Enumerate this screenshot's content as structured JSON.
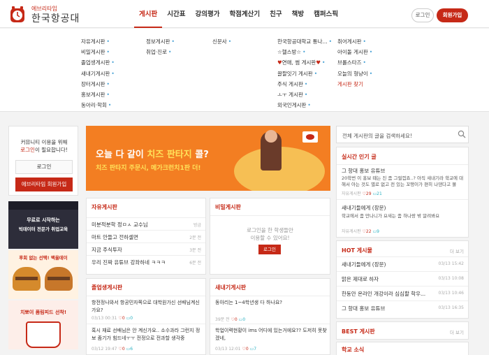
{
  "header": {
    "logo_sub": "에브리타임",
    "logo_main": "한국항공대",
    "nav": [
      "게시판",
      "시간표",
      "강의평가",
      "학점계산기",
      "친구",
      "책방",
      "캠퍼스픽"
    ],
    "login": "로그인",
    "signup": "회원가입"
  },
  "menu": {
    "col1": [
      "자유게시판",
      "비밀게시판",
      "졸업생게시판",
      "새내기게시판",
      "장터게시판",
      "홍보게시판",
      "동아리·학회"
    ],
    "col2": [
      "정보게시판",
      "취업·진로"
    ],
    "col3": [
      "신문사"
    ],
    "col4": [
      "한국항공대학교 통나...",
      "☆헬스방☆",
      "연애, 썸 게시판",
      "끌팔잇기 게시판",
      "주식 게시판",
      "ㅗㅜ 게시판",
      "외국인게시판"
    ],
    "col5": [
      "취어게시판",
      "아이돌 게시판",
      "브롤스타즈",
      "오늘의 형냥이",
      "게시판 찾기"
    ]
  },
  "login_box": {
    "line1": "커뮤니티 이용을 위해",
    "line2_red": "로그인",
    "line2_rest": "이 필요합니다!",
    "login_btn": "로그인",
    "signup_btn": "에브리타임 회원가입"
  },
  "ads": {
    "ad1_title": "무료로 시작하는",
    "ad1_sub": "빅데이터 전문가 취업교육",
    "ad2_title": "후회 없는 선택! 맥올데이",
    "ad3_title": "치뽀이 폼림피드 선착!"
  },
  "banner": {
    "line1_a": "오늘 다 같이 ",
    "line1_b": "치즈 판타지",
    "line1_c": " 콜?",
    "line2": "치즈 판타지 주문시, 메가크런치1판 더!"
  },
  "free_board": {
    "title": "자유게시판",
    "rows": [
      {
        "text": "미분적분학 정ㅁㅅ 교수님",
        "meta": "방금"
      },
      {
        "text": "마트 안들고 전하셀면",
        "meta": "2분 전"
      },
      {
        "text": "지금 주식투자",
        "meta": "3분 전"
      },
      {
        "text": "우리 진짜 유튜브 강좌하네 ㅋㅋㅋ",
        "meta": "6분 전"
      }
    ]
  },
  "secret_board": {
    "title": "비밀게시판",
    "msg1": "로그인을 한 학생들만",
    "msg2": "이용할 수 있어요!",
    "btn": "로그인"
  },
  "grad_board": {
    "title": "졸업생게시판",
    "post1": "항전정나와서 항공민자쪽으로 대학원가신 선배님계신가요?",
    "meta1": "03/13 00:31",
    "post1_likes": "0",
    "post1_comments": "0",
    "post2": "혹시 재료 선배님은 안 계신가요.. 소수과라 그런지 정보 좀기가 힘드네ㅜㅜ 전정으로 전과할 생각중",
    "meta2": "03/12 19:47",
    "post2_likes": "0",
    "post2_comments": "6"
  },
  "fresh_board": {
    "title": "새내기게시판",
    "post1": "동아리는 1~4학년생 다 하나요?",
    "meta1": "39분 전",
    "post1_likes": "0",
    "post1_comments": "0",
    "post2": "학업이력현황이 ims 어디에 있는거에요?? 도저히 못찾겠네,",
    "meta2": "03/13 12:01",
    "post2_likes": "0",
    "post2_comments": "7"
  },
  "search": {
    "placeholder": "전체 게시판의 글을 검색하세요!"
  },
  "realtime": {
    "title": "실시간 인기 글",
    "p1_title": "그 항대 홍보 유튜브",
    "p1_body": "20학번 이 홍보 때는 진 좀 그럴껍죠..? 아직 새내기라 학교에 대해서 아는 것도 별로 없고 전 있는 꼬맹이가 편히 나댄다고 볼",
    "p1_board": "자유게시판",
    "p1_likes": "29",
    "p1_comments": "21",
    "p2_title": "새내기들에게 (장문)",
    "p2_body": "학교에서 좀 만나니가 요새는 좀 하나랑 밖 알려봐요",
    "p2_board": "자유게시판",
    "p2_likes": "22",
    "p2_comments": "9"
  },
  "hot": {
    "title": "HOT 게시물",
    "more": "더 보기",
    "rows": [
      {
        "text": "새내기들에게 (장문)",
        "meta": "03/13 15:42"
      },
      {
        "text": "맑은 제대로 하자",
        "meta": "03/13 10:08"
      },
      {
        "text": "한동안 온라인 개강이라 심심할 학우...",
        "meta": "03/13 10:46"
      },
      {
        "text": "그 항대 홍보 유튜브",
        "meta": "03/13 16:35"
      }
    ]
  },
  "best": {
    "title": "BEST 게시판",
    "more": "더 보기"
  },
  "school_news": {
    "title": "학교 소식"
  }
}
